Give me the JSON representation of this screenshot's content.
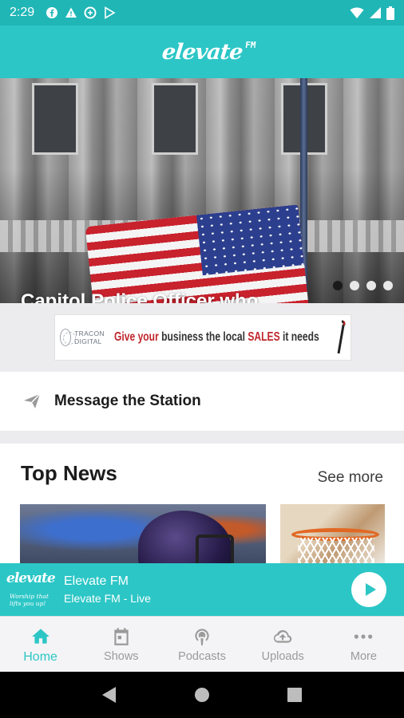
{
  "status_bar": {
    "time": "2:29",
    "icons": [
      "facebook-icon",
      "alert-icon",
      "data-saver-icon",
      "play-store-icon"
    ],
    "right_icons": [
      "wifi-icon",
      "signal-icon",
      "battery-icon"
    ]
  },
  "app_bar": {
    "logo_text": "elevate",
    "logo_suffix": "FM"
  },
  "hero": {
    "headline": "Capitol Police Officer who responded to insurrection dies while off duty",
    "slide_count": 4,
    "active_slide": 0
  },
  "ad": {
    "brand": "TRACON DIGITAL",
    "tagline_part1": "Give your",
    "tagline_part2": "business the local",
    "tagline_part3": "SALES",
    "tagline_part4": "it needs"
  },
  "message_row": {
    "label": "Message the Station",
    "icon": "send-icon"
  },
  "top_news": {
    "title": "Top News",
    "see_more": "See more"
  },
  "player": {
    "logo_text": "elevate",
    "logo_slogan": "Worship that lifts you up!",
    "station": "Elevate FM",
    "subtitle": "Elevate FM - Live"
  },
  "bottom_nav": {
    "items": [
      {
        "label": "Home",
        "icon": "home-icon",
        "active": true
      },
      {
        "label": "Shows",
        "icon": "calendar-icon",
        "active": false
      },
      {
        "label": "Podcasts",
        "icon": "podcast-icon",
        "active": false
      },
      {
        "label": "Uploads",
        "icon": "upload-icon",
        "active": false
      },
      {
        "label": "More",
        "icon": "more-icon",
        "active": false
      }
    ]
  },
  "colors": {
    "accent": "#2cc6c6",
    "status_bar": "#21b6b6",
    "inactive": "#9a9a9a"
  }
}
